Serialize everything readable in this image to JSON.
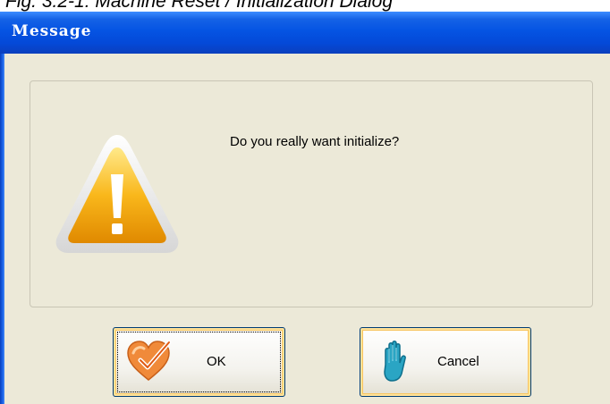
{
  "caption": "Fig. 3.2-1: Machine Reset / Initialization Dialog",
  "window": {
    "title": "Message"
  },
  "dialog": {
    "message": "Do you really want initialize?",
    "icon": "warning-icon"
  },
  "buttons": {
    "ok_label": "OK",
    "ok_icon": "checkmark-heart-icon",
    "cancel_label": "Cancel",
    "cancel_icon": "hand-stop-icon"
  },
  "colors": {
    "titlebar": "#0554e3",
    "window_bg": "#ece9d8",
    "button_highlight": "#f8c560"
  }
}
